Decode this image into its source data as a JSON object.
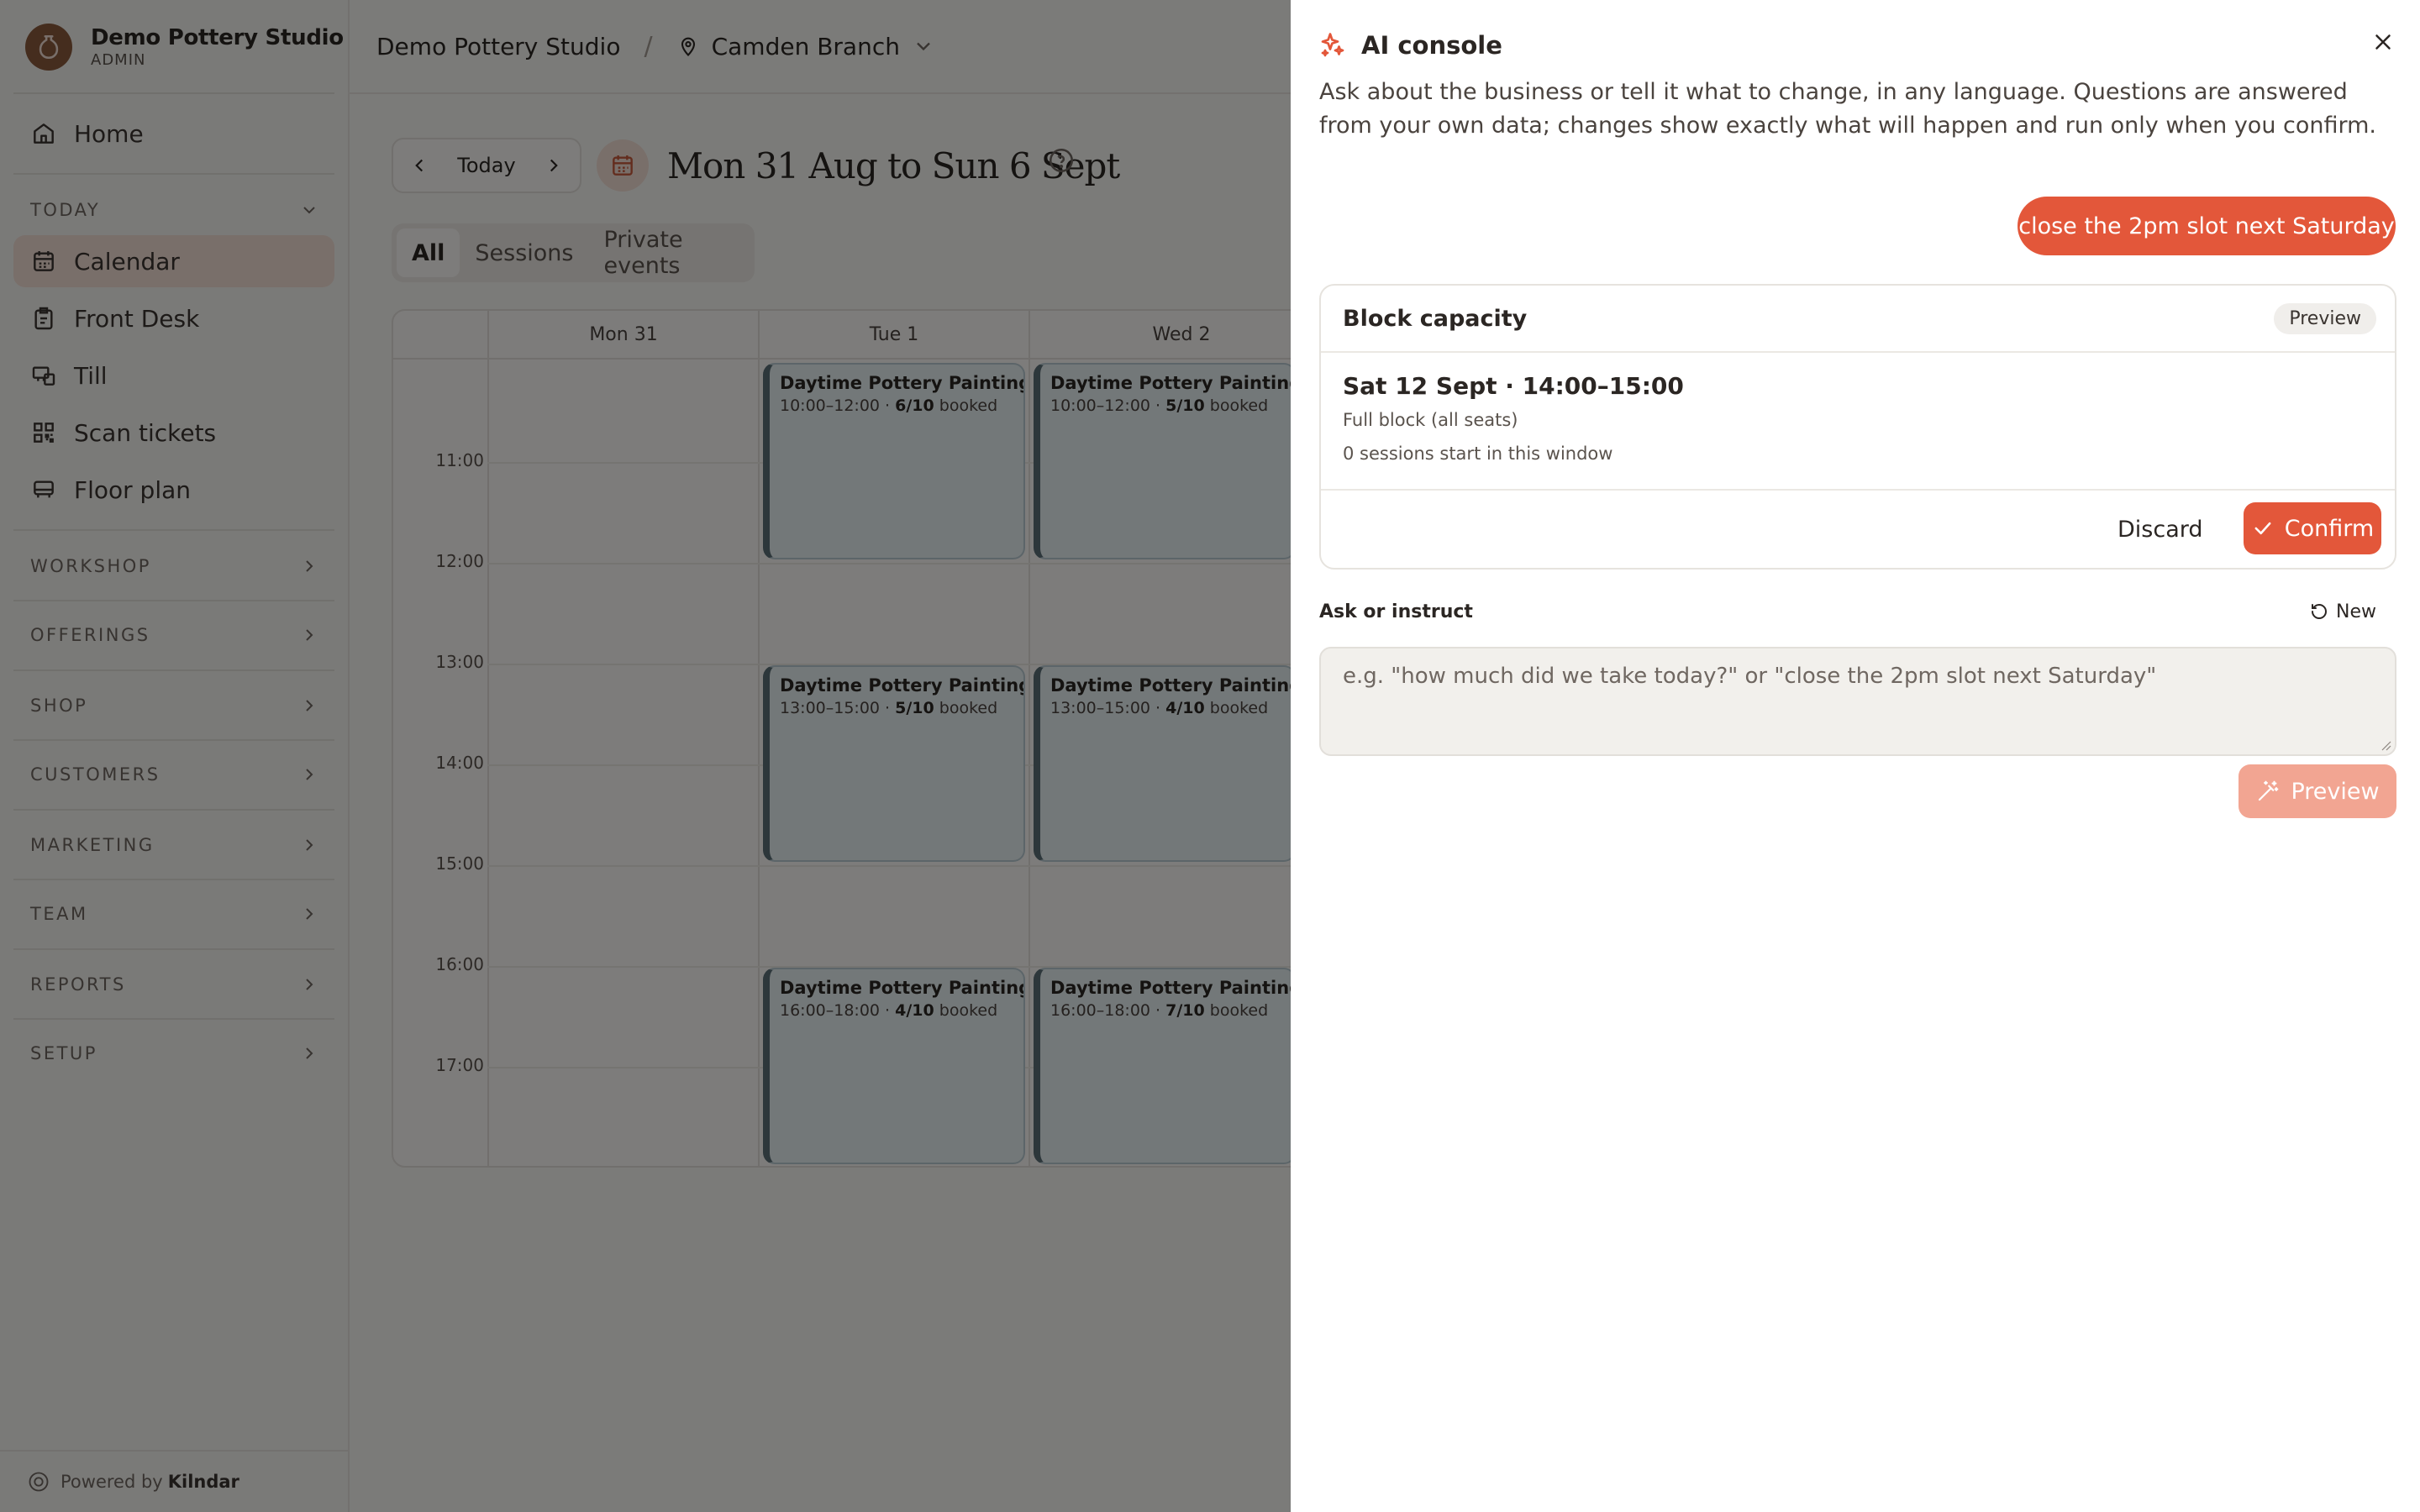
{
  "colors": {
    "accent": "#e3573a",
    "accent_soft": "#f3ded5",
    "event_border": "#5a6e76"
  },
  "brand": {
    "name": "Demo Pottery Studio",
    "role": "ADMIN"
  },
  "sidebar": {
    "home": "Home",
    "today_section": "TODAY",
    "items": [
      "Calendar",
      "Front Desk",
      "Till",
      "Scan tickets",
      "Floor plan"
    ],
    "sections": [
      "WORKSHOP",
      "OFFERINGS",
      "SHOP",
      "CUSTOMERS",
      "MARKETING",
      "TEAM",
      "REPORTS",
      "SETUP"
    ],
    "powered_prefix": "Powered by",
    "powered_brand": "Kilndar"
  },
  "topbar": {
    "studio": "Demo Pottery Studio",
    "separator": "/",
    "branch": "Camden Branch"
  },
  "calendar": {
    "today_label": "Today",
    "range_title": "Mon 31 Aug to Sun 6 Sept",
    "tabs": [
      "All",
      "Sessions",
      "Private events"
    ],
    "days": [
      "Mon 31",
      "Tue 1",
      "Wed 2"
    ],
    "hours": [
      "11:00",
      "12:00",
      "13:00",
      "14:00",
      "15:00",
      "16:00",
      "17:00"
    ],
    "events": [
      {
        "title": "Daytime Pottery Painting",
        "time": "10:00–12:00 ·",
        "booked": "6/10",
        "suffix": "booked"
      },
      {
        "title": "Daytime Pottery Painting",
        "time": "10:00–12:00 ·",
        "booked": "5/10",
        "suffix": "booked"
      },
      {
        "title": "Daytime Pottery Painting",
        "time": "13:00–15:00 ·",
        "booked": "5/10",
        "suffix": "booked"
      },
      {
        "title": "Daytime Pottery Painting",
        "time": "13:00–15:00 ·",
        "booked": "4/10",
        "suffix": "booked"
      },
      {
        "title": "Daytime Pottery Painting",
        "time": "16:00–18:00 ·",
        "booked": "4/10",
        "suffix": "booked"
      },
      {
        "title": "Daytime Pottery Painting",
        "time": "16:00–18:00 ·",
        "booked": "7/10",
        "suffix": "booked"
      }
    ]
  },
  "console": {
    "title": "AI console",
    "intro": "Ask about the business or tell it what to change, in any language. Questions are answered from your own data; changes show exactly what will happen and run only when you confirm.",
    "user_message": "close the 2pm slot next Saturday",
    "card": {
      "title": "Block capacity",
      "badge": "Preview",
      "slot": "Sat 12 Sept · 14:00–15:00",
      "detail1": "Full block (all seats)",
      "detail2": "0 sessions start in this window",
      "discard": "Discard",
      "confirm": "Confirm"
    },
    "ask_label": "Ask or instruct",
    "new_label": "New",
    "input_value": "",
    "input_placeholder": "e.g. \"how much did we take today?\" or \"close the 2pm slot next Saturday\"",
    "preview_label": "Preview"
  }
}
